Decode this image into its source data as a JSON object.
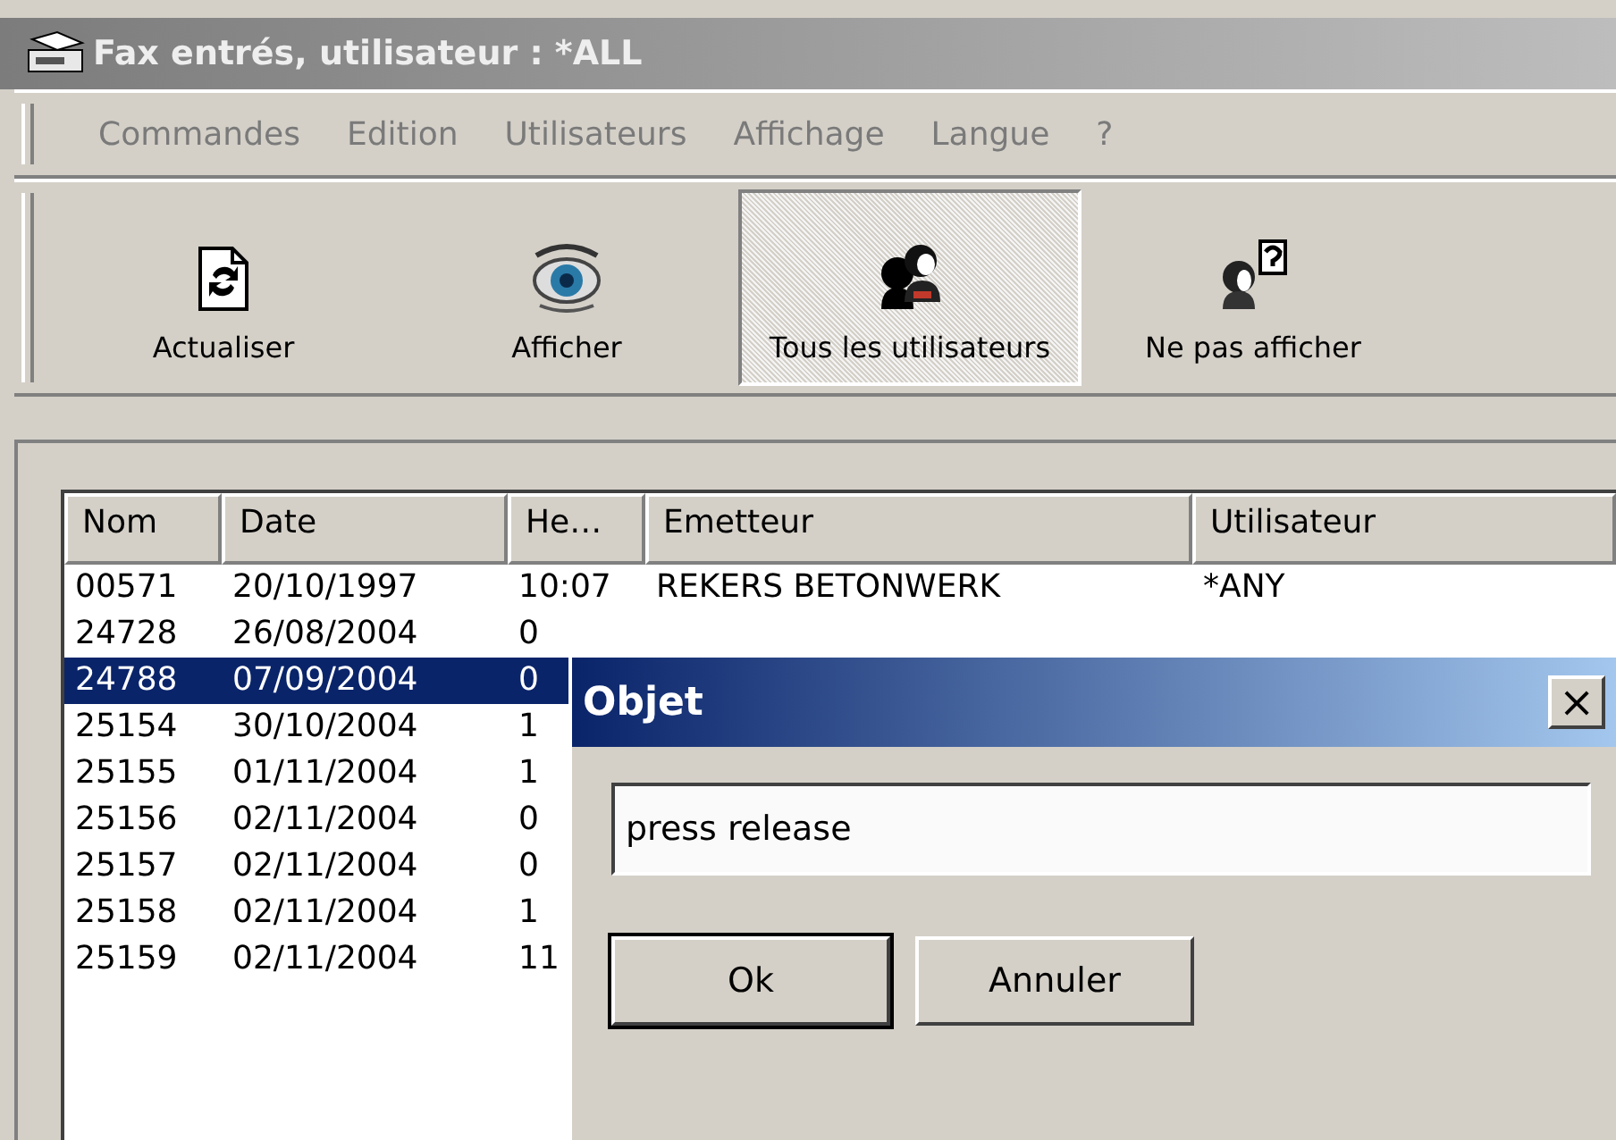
{
  "window": {
    "title": "Fax entrés, utilisateur : *ALL"
  },
  "menu": [
    {
      "label": "Commandes"
    },
    {
      "label": "Edition"
    },
    {
      "label": "Utilisateurs"
    },
    {
      "label": "Affichage"
    },
    {
      "label": "Langue"
    },
    {
      "label": "?"
    }
  ],
  "toolbar": [
    {
      "kind": "refresh",
      "label": "Actualiser",
      "selected": false
    },
    {
      "kind": "eye",
      "label": "Afficher",
      "selected": false
    },
    {
      "kind": "users",
      "label": "Tous les utilisateurs",
      "selected": true
    },
    {
      "kind": "hide",
      "label": "Ne pas afficher",
      "selected": false
    }
  ],
  "table": {
    "columns": [
      "Nom",
      "Date",
      "He…",
      "Emetteur",
      "Utilisateur"
    ],
    "rows": [
      {
        "cells": [
          "00571",
          "20/10/1997",
          "10:07",
          "REKERS BETONWERK",
          "*ANY"
        ],
        "selected": false
      },
      {
        "cells": [
          "24728",
          "26/08/2004",
          "0"
        ],
        "selected": false
      },
      {
        "cells": [
          "24788",
          "07/09/2004",
          "0"
        ],
        "selected": true
      },
      {
        "cells": [
          "25154",
          "30/10/2004",
          "1"
        ],
        "selected": false
      },
      {
        "cells": [
          "25155",
          "01/11/2004",
          "1"
        ],
        "selected": false
      },
      {
        "cells": [
          "25156",
          "02/11/2004",
          "0"
        ],
        "selected": false
      },
      {
        "cells": [
          "25157",
          "02/11/2004",
          "0"
        ],
        "selected": false
      },
      {
        "cells": [
          "25158",
          "02/11/2004",
          "1"
        ],
        "selected": false
      },
      {
        "cells": [
          "25159",
          "02/11/2004",
          "11"
        ],
        "selected": false
      }
    ]
  },
  "dialog": {
    "title": "Objet",
    "close": "×",
    "value": "press release",
    "buttons": [
      {
        "label": "Ok",
        "default": true
      },
      {
        "label": "Annuler",
        "default": false
      }
    ]
  }
}
